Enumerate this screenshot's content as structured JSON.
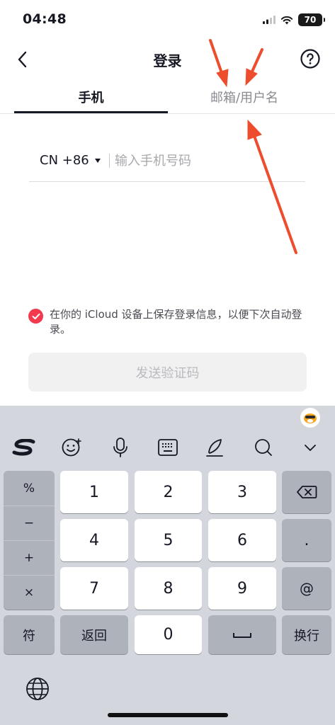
{
  "status": {
    "time": "04:48",
    "battery": "70"
  },
  "nav": {
    "title": "登录"
  },
  "tabs": [
    {
      "label": "手机"
    },
    {
      "label": "邮箱/用户名"
    }
  ],
  "phone": {
    "country_code": "CN +86",
    "placeholder": "输入手机号码"
  },
  "consent": {
    "text": "在你的 iCloud 设备上保存登录信息，以便下次自动登录。"
  },
  "send_button": {
    "label": "发送验证码"
  },
  "keyboard": {
    "symbols": [
      "%",
      "−",
      "+",
      "×"
    ],
    "digits": [
      "1",
      "2",
      "3",
      "4",
      "5",
      "6",
      "7",
      "8",
      "9",
      "0"
    ],
    "side_keys": [
      ".",
      "@"
    ],
    "bottom": {
      "symbols": "符",
      "back": "返回",
      "return": "换行"
    }
  },
  "colors": {
    "accent": "#f2394e",
    "arrow": "#ee4d2d"
  }
}
